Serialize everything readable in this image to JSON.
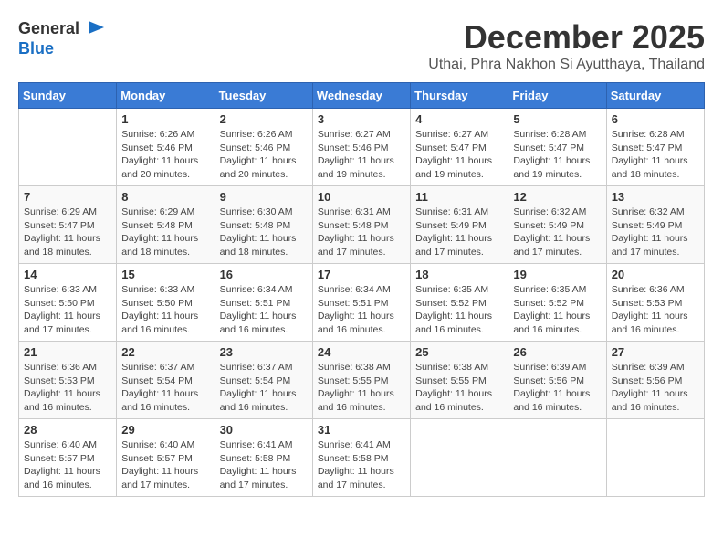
{
  "logo": {
    "general": "General",
    "blue": "Blue"
  },
  "header": {
    "month": "December 2025",
    "location": "Uthai, Phra Nakhon Si Ayutthaya, Thailand"
  },
  "weekdays": [
    "Sunday",
    "Monday",
    "Tuesday",
    "Wednesday",
    "Thursday",
    "Friday",
    "Saturday"
  ],
  "weeks": [
    [
      {
        "day": "",
        "sunrise": "",
        "sunset": "",
        "daylight": ""
      },
      {
        "day": "1",
        "sunrise": "Sunrise: 6:26 AM",
        "sunset": "Sunset: 5:46 PM",
        "daylight": "Daylight: 11 hours and 20 minutes."
      },
      {
        "day": "2",
        "sunrise": "Sunrise: 6:26 AM",
        "sunset": "Sunset: 5:46 PM",
        "daylight": "Daylight: 11 hours and 20 minutes."
      },
      {
        "day": "3",
        "sunrise": "Sunrise: 6:27 AM",
        "sunset": "Sunset: 5:46 PM",
        "daylight": "Daylight: 11 hours and 19 minutes."
      },
      {
        "day": "4",
        "sunrise": "Sunrise: 6:27 AM",
        "sunset": "Sunset: 5:47 PM",
        "daylight": "Daylight: 11 hours and 19 minutes."
      },
      {
        "day": "5",
        "sunrise": "Sunrise: 6:28 AM",
        "sunset": "Sunset: 5:47 PM",
        "daylight": "Daylight: 11 hours and 19 minutes."
      },
      {
        "day": "6",
        "sunrise": "Sunrise: 6:28 AM",
        "sunset": "Sunset: 5:47 PM",
        "daylight": "Daylight: 11 hours and 18 minutes."
      }
    ],
    [
      {
        "day": "7",
        "sunrise": "Sunrise: 6:29 AM",
        "sunset": "Sunset: 5:47 PM",
        "daylight": "Daylight: 11 hours and 18 minutes."
      },
      {
        "day": "8",
        "sunrise": "Sunrise: 6:29 AM",
        "sunset": "Sunset: 5:48 PM",
        "daylight": "Daylight: 11 hours and 18 minutes."
      },
      {
        "day": "9",
        "sunrise": "Sunrise: 6:30 AM",
        "sunset": "Sunset: 5:48 PM",
        "daylight": "Daylight: 11 hours and 18 minutes."
      },
      {
        "day": "10",
        "sunrise": "Sunrise: 6:31 AM",
        "sunset": "Sunset: 5:48 PM",
        "daylight": "Daylight: 11 hours and 17 minutes."
      },
      {
        "day": "11",
        "sunrise": "Sunrise: 6:31 AM",
        "sunset": "Sunset: 5:49 PM",
        "daylight": "Daylight: 11 hours and 17 minutes."
      },
      {
        "day": "12",
        "sunrise": "Sunrise: 6:32 AM",
        "sunset": "Sunset: 5:49 PM",
        "daylight": "Daylight: 11 hours and 17 minutes."
      },
      {
        "day": "13",
        "sunrise": "Sunrise: 6:32 AM",
        "sunset": "Sunset: 5:49 PM",
        "daylight": "Daylight: 11 hours and 17 minutes."
      }
    ],
    [
      {
        "day": "14",
        "sunrise": "Sunrise: 6:33 AM",
        "sunset": "Sunset: 5:50 PM",
        "daylight": "Daylight: 11 hours and 17 minutes."
      },
      {
        "day": "15",
        "sunrise": "Sunrise: 6:33 AM",
        "sunset": "Sunset: 5:50 PM",
        "daylight": "Daylight: 11 hours and 16 minutes."
      },
      {
        "day": "16",
        "sunrise": "Sunrise: 6:34 AM",
        "sunset": "Sunset: 5:51 PM",
        "daylight": "Daylight: 11 hours and 16 minutes."
      },
      {
        "day": "17",
        "sunrise": "Sunrise: 6:34 AM",
        "sunset": "Sunset: 5:51 PM",
        "daylight": "Daylight: 11 hours and 16 minutes."
      },
      {
        "day": "18",
        "sunrise": "Sunrise: 6:35 AM",
        "sunset": "Sunset: 5:52 PM",
        "daylight": "Daylight: 11 hours and 16 minutes."
      },
      {
        "day": "19",
        "sunrise": "Sunrise: 6:35 AM",
        "sunset": "Sunset: 5:52 PM",
        "daylight": "Daylight: 11 hours and 16 minutes."
      },
      {
        "day": "20",
        "sunrise": "Sunrise: 6:36 AM",
        "sunset": "Sunset: 5:53 PM",
        "daylight": "Daylight: 11 hours and 16 minutes."
      }
    ],
    [
      {
        "day": "21",
        "sunrise": "Sunrise: 6:36 AM",
        "sunset": "Sunset: 5:53 PM",
        "daylight": "Daylight: 11 hours and 16 minutes."
      },
      {
        "day": "22",
        "sunrise": "Sunrise: 6:37 AM",
        "sunset": "Sunset: 5:54 PM",
        "daylight": "Daylight: 11 hours and 16 minutes."
      },
      {
        "day": "23",
        "sunrise": "Sunrise: 6:37 AM",
        "sunset": "Sunset: 5:54 PM",
        "daylight": "Daylight: 11 hours and 16 minutes."
      },
      {
        "day": "24",
        "sunrise": "Sunrise: 6:38 AM",
        "sunset": "Sunset: 5:55 PM",
        "daylight": "Daylight: 11 hours and 16 minutes."
      },
      {
        "day": "25",
        "sunrise": "Sunrise: 6:38 AM",
        "sunset": "Sunset: 5:55 PM",
        "daylight": "Daylight: 11 hours and 16 minutes."
      },
      {
        "day": "26",
        "sunrise": "Sunrise: 6:39 AM",
        "sunset": "Sunset: 5:56 PM",
        "daylight": "Daylight: 11 hours and 16 minutes."
      },
      {
        "day": "27",
        "sunrise": "Sunrise: 6:39 AM",
        "sunset": "Sunset: 5:56 PM",
        "daylight": "Daylight: 11 hours and 16 minutes."
      }
    ],
    [
      {
        "day": "28",
        "sunrise": "Sunrise: 6:40 AM",
        "sunset": "Sunset: 5:57 PM",
        "daylight": "Daylight: 11 hours and 16 minutes."
      },
      {
        "day": "29",
        "sunrise": "Sunrise: 6:40 AM",
        "sunset": "Sunset: 5:57 PM",
        "daylight": "Daylight: 11 hours and 17 minutes."
      },
      {
        "day": "30",
        "sunrise": "Sunrise: 6:41 AM",
        "sunset": "Sunset: 5:58 PM",
        "daylight": "Daylight: 11 hours and 17 minutes."
      },
      {
        "day": "31",
        "sunrise": "Sunrise: 6:41 AM",
        "sunset": "Sunset: 5:58 PM",
        "daylight": "Daylight: 11 hours and 17 minutes."
      },
      {
        "day": "",
        "sunrise": "",
        "sunset": "",
        "daylight": ""
      },
      {
        "day": "",
        "sunrise": "",
        "sunset": "",
        "daylight": ""
      },
      {
        "day": "",
        "sunrise": "",
        "sunset": "",
        "daylight": ""
      }
    ]
  ]
}
